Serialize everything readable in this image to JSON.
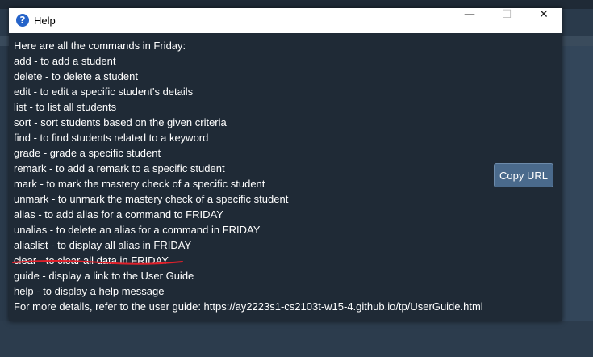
{
  "window": {
    "title": "Help",
    "minimize_glyph": "—",
    "maximize_glyph": "☐",
    "close_glyph": "✕"
  },
  "help": {
    "lines": [
      "Here are all the commands in Friday:",
      "add - to add a student",
      "delete - to delete a student",
      "edit - to edit a specific student's details",
      "list - to list all students",
      "sort - sort students based on the given criteria",
      "find - to find students related to a keyword",
      "grade - grade a specific student",
      "remark - to add a remark to a specific student",
      "mark - to mark the mastery check of a specific student",
      "unmark - to unmark the mastery check of a specific student",
      "alias - to add alias for a command to FRIDAY",
      "unalias - to delete an alias for a command in FRIDAY",
      "aliaslist - to display all alias in FRIDAY",
      "clear - to clear all data in FRIDAY",
      "guide - display a link to the User Guide",
      "help - to display a help message",
      "For more details, refer to the user guide: https://ay2223s1-cs2103t-w15-4.github.io/tp/UserGuide.html"
    ]
  },
  "buttons": {
    "copy_url": "Copy URL"
  },
  "colors": {
    "window_bg": "#1f2a36",
    "text": "#ffffff",
    "annotation_red": "#e0202a",
    "button_bg": "#4a6a8c"
  },
  "icons": {
    "title": "help-question-icon"
  }
}
